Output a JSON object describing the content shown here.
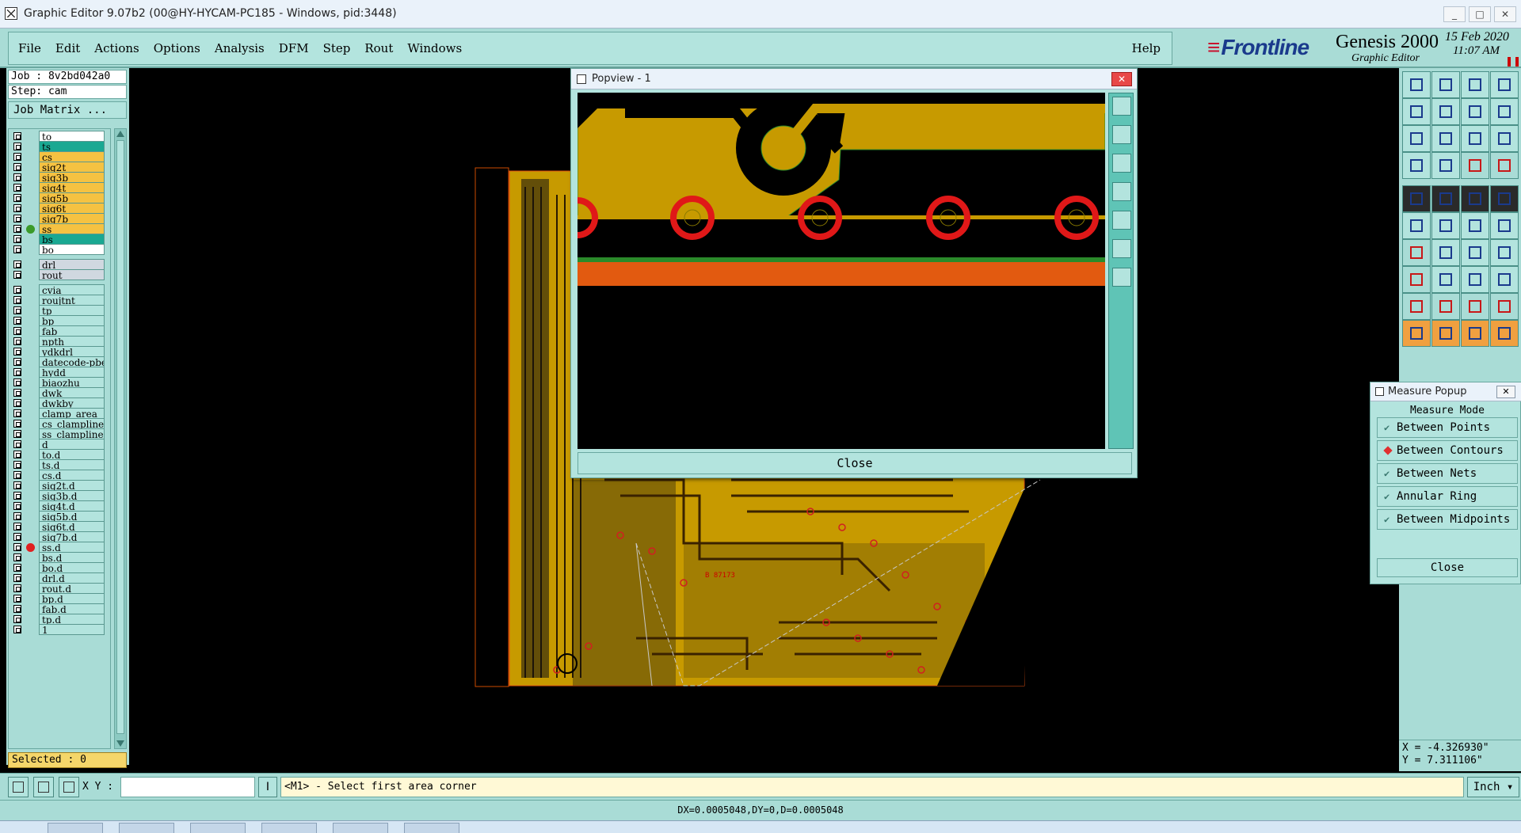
{
  "window": {
    "title": "Graphic Editor 9.07b2 (00@HY-HYCAM-PC185 - Windows, pid:3448)",
    "controls": [
      "_",
      "□",
      "✕"
    ]
  },
  "menu": {
    "items": [
      "File",
      "Edit",
      "Actions",
      "Options",
      "Analysis",
      "DFM",
      "Step",
      "Rout",
      "Windows"
    ],
    "help": "Help"
  },
  "brand": {
    "logo": "Frontline",
    "product": "Genesis 2000",
    "subtitle": "Graphic Editor",
    "date": "15 Feb 2020",
    "time": "11:07 AM"
  },
  "job": {
    "job_label": "Job : 8v2bd042a0",
    "step_label": "Step: cam",
    "matrix_button": "Job Matrix ..."
  },
  "layers": [
    {
      "name": "to",
      "bg": "#ffffff",
      "arrow": true,
      "dot": ""
    },
    {
      "name": "ts",
      "bg": "#1aa892",
      "arrow": false,
      "dot": ""
    },
    {
      "name": "cs",
      "bg": "#f5c242",
      "arrow": true,
      "dot": ""
    },
    {
      "name": "sig2t",
      "bg": "#f5c242",
      "arrow": true,
      "dot": ""
    },
    {
      "name": "sig3b",
      "bg": "#f5c242",
      "arrow": true,
      "dot": ""
    },
    {
      "name": "sig4t",
      "bg": "#f5c242",
      "arrow": true,
      "dot": ""
    },
    {
      "name": "sig5b",
      "bg": "#f5c242",
      "arrow": true,
      "dot": ""
    },
    {
      "name": "sig6t",
      "bg": "#f5c242",
      "arrow": true,
      "dot": ""
    },
    {
      "name": "sig7b",
      "bg": "#f5c242",
      "arrow": true,
      "dot": ""
    },
    {
      "name": "ss",
      "bg": "#f5c242",
      "arrow": true,
      "dot": "#3a9a2a"
    },
    {
      "name": "bs",
      "bg": "#1aa892",
      "arrow": false,
      "dot": ""
    },
    {
      "name": "bo",
      "bg": "#ffffff",
      "arrow": true,
      "dot": ""
    },
    {
      "name": "drl",
      "bg": "#d0d8e0",
      "arrow": false,
      "dot": ""
    },
    {
      "name": "rout",
      "bg": "#d0d8e0",
      "arrow": false,
      "dot": ""
    },
    {
      "name": "cvia",
      "bg": "#b3e4de",
      "arrow": false,
      "dot": ""
    },
    {
      "name": "roujtnt",
      "bg": "#b3e4de",
      "arrow": false,
      "dot": ""
    },
    {
      "name": "tp",
      "bg": "#b3e4de",
      "arrow": false,
      "dot": ""
    },
    {
      "name": "bp",
      "bg": "#b3e4de",
      "arrow": false,
      "dot": ""
    },
    {
      "name": "fab",
      "bg": "#b3e4de",
      "arrow": true,
      "dot": ""
    },
    {
      "name": "npth",
      "bg": "#b3e4de",
      "arrow": false,
      "dot": ""
    },
    {
      "name": "ydkdrl",
      "bg": "#b3e4de",
      "arrow": false,
      "dot": ""
    },
    {
      "name": "datecode-pbe",
      "bg": "#b3e4de",
      "arrow": false,
      "dot": ""
    },
    {
      "name": "hydd",
      "bg": "#b3e4de",
      "arrow": false,
      "dot": ""
    },
    {
      "name": "biaozhu",
      "bg": "#b3e4de",
      "arrow": false,
      "dot": ""
    },
    {
      "name": "dwk",
      "bg": "#b3e4de",
      "arrow": false,
      "dot": ""
    },
    {
      "name": "dwkby",
      "bg": "#b3e4de",
      "arrow": false,
      "dot": ""
    },
    {
      "name": "clamp_area",
      "bg": "#b3e4de",
      "arrow": false,
      "dot": ""
    },
    {
      "name": "cs_clampline",
      "bg": "#b3e4de",
      "arrow": false,
      "dot": ""
    },
    {
      "name": "ss_clampline",
      "bg": "#b3e4de",
      "arrow": false,
      "dot": ""
    },
    {
      "name": "d",
      "bg": "#b3e4de",
      "arrow": false,
      "dot": ""
    },
    {
      "name": "to.d",
      "bg": "#b3e4de",
      "arrow": true,
      "dot": ""
    },
    {
      "name": "ts.d",
      "bg": "#b3e4de",
      "arrow": false,
      "dot": ""
    },
    {
      "name": "cs.d",
      "bg": "#b3e4de",
      "arrow": true,
      "dot": ""
    },
    {
      "name": "sig2t.d",
      "bg": "#b3e4de",
      "arrow": true,
      "dot": ""
    },
    {
      "name": "sig3b.d",
      "bg": "#b3e4de",
      "arrow": true,
      "dot": ""
    },
    {
      "name": "sig4t.d",
      "bg": "#b3e4de",
      "arrow": true,
      "dot": ""
    },
    {
      "name": "sig5b.d",
      "bg": "#b3e4de",
      "arrow": true,
      "dot": ""
    },
    {
      "name": "sig6t.d",
      "bg": "#b3e4de",
      "arrow": true,
      "dot": ""
    },
    {
      "name": "sig7b.d",
      "bg": "#b3e4de",
      "arrow": true,
      "dot": ""
    },
    {
      "name": "ss.d",
      "bg": "#b3e4de",
      "arrow": true,
      "dot": "#e02020"
    },
    {
      "name": "bs.d",
      "bg": "#b3e4de",
      "arrow": false,
      "dot": ""
    },
    {
      "name": "bo.d",
      "bg": "#b3e4de",
      "arrow": true,
      "dot": ""
    },
    {
      "name": "drl.d",
      "bg": "#b3e4de",
      "arrow": false,
      "dot": ""
    },
    {
      "name": "rout.d",
      "bg": "#b3e4de",
      "arrow": false,
      "dot": ""
    },
    {
      "name": "bp.d",
      "bg": "#b3e4de",
      "arrow": false,
      "dot": ""
    },
    {
      "name": "fab.d",
      "bg": "#b3e4de",
      "arrow": true,
      "dot": ""
    },
    {
      "name": "tp.d",
      "bg": "#b3e4de",
      "arrow": true,
      "dot": ""
    },
    {
      "name": "1",
      "bg": "#b3e4de",
      "arrow": false,
      "dot": ""
    }
  ],
  "selected_label": "Selected : 0",
  "popview": {
    "title": "Popview - 1",
    "close_label": "Close"
  },
  "measure": {
    "title": "Measure Popup",
    "mode_label": "Measure Mode",
    "options": [
      {
        "label": "Between Points",
        "active": false
      },
      {
        "label": "Between Contours",
        "active": true
      },
      {
        "label": "Between Nets",
        "active": false
      },
      {
        "label": "Annular Ring",
        "active": false
      },
      {
        "label": "Between Midpoints",
        "active": false
      }
    ],
    "close_label": "Close"
  },
  "coords": {
    "x": "X = -4.326930\"",
    "y": "Y = 7.311106\""
  },
  "status": {
    "xy_label": "X Y :",
    "xy_value": "",
    "prompt": "<M1> - Select first area corner",
    "units": "Inch ▾",
    "dx_line": "DX=0.0005048,DY=0,D=0.0005048"
  },
  "pcb_label": "B 87173",
  "colors": {
    "accent": "#a9dcd6",
    "copper": "#c79a00",
    "drill_ring": "#e01818",
    "orange_band": "#e25a10"
  }
}
